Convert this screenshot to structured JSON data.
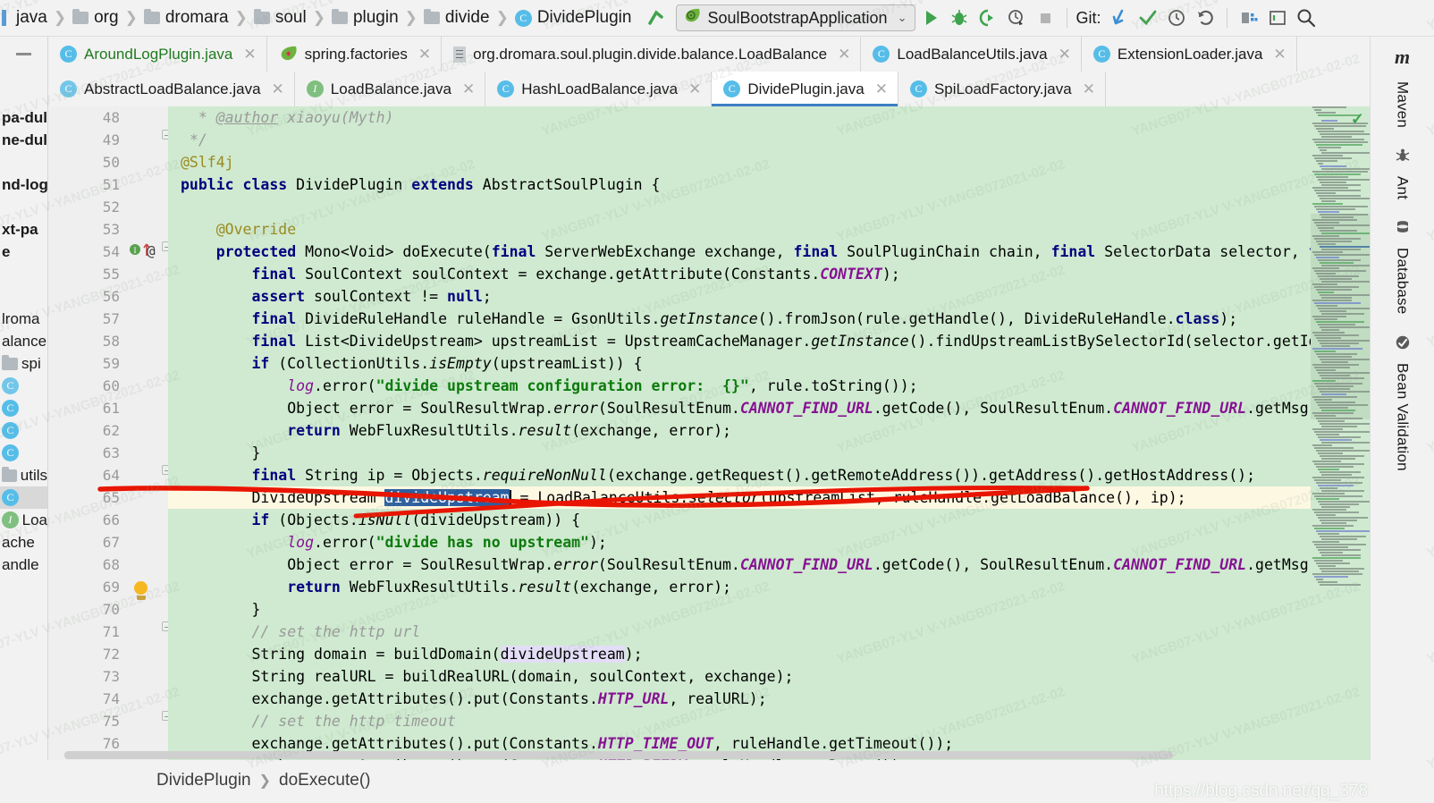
{
  "navbar": {
    "breadcrumbs": [
      {
        "label": "java",
        "icon": "blue-bar-icon"
      },
      {
        "label": "org",
        "icon": "folder-icon"
      },
      {
        "label": "dromara",
        "icon": "folder-icon"
      },
      {
        "label": "soul",
        "icon": "folder-icon"
      },
      {
        "label": "plugin",
        "icon": "folder-icon"
      },
      {
        "label": "divide",
        "icon": "folder-icon"
      },
      {
        "label": "DividePlugin",
        "icon": "class-icon"
      }
    ],
    "run_config": "SoulBootstrapApplication",
    "git_label": "Git:",
    "toolbar_icons": [
      "back-arrow-icon",
      "run-icon",
      "debug-icon",
      "run-with-coverage-icon",
      "profile-icon",
      "stop-icon",
      "git-update-icon",
      "git-commit-icon",
      "git-history-icon",
      "git-rollback-icon",
      "project-structure-icon",
      "terminal-icon",
      "search-everywhere-icon"
    ]
  },
  "tabs_row1": [
    {
      "label": "AroundLogPlugin.java",
      "icon": "class-icon",
      "active": false,
      "green": true
    },
    {
      "label": "spring.factories",
      "icon": "spring-leaf-icon",
      "active": false,
      "green": false
    },
    {
      "label": "org.dromara.soul.plugin.divide.balance.LoadBalance",
      "icon": "xml-file-icon",
      "active": false,
      "green": false
    },
    {
      "label": "LoadBalanceUtils.java",
      "icon": "class-icon",
      "active": false,
      "green": false
    },
    {
      "label": "ExtensionLoader.java",
      "icon": "class-icon",
      "active": false,
      "green": false
    }
  ],
  "tabs_row2": [
    {
      "label": "AbstractLoadBalance.java",
      "icon": "abstract-class-icon",
      "active": false
    },
    {
      "label": "LoadBalance.java",
      "icon": "interface-icon",
      "active": false
    },
    {
      "label": "HashLoadBalance.java",
      "icon": "class-icon",
      "active": false
    },
    {
      "label": "DividePlugin.java",
      "icon": "class-icon",
      "active": true
    },
    {
      "label": "SpiLoadFactory.java",
      "icon": "class-icon",
      "active": false
    }
  ],
  "project_strip": [
    {
      "label": "pa-dul",
      "bold": true
    },
    {
      "label": "ne-dul",
      "bold": true
    },
    {
      "label": "",
      "bold": false
    },
    {
      "label": "nd-log",
      "bold": true
    },
    {
      "label": "",
      "bold": false
    },
    {
      "label": "xt-pa",
      "bold": true
    },
    {
      "label": "e",
      "bold": true
    },
    {
      "label": "",
      "bold": false
    },
    {
      "label": "",
      "bold": false
    },
    {
      "label": "lroma",
      "bold": false
    },
    {
      "label": "alance",
      "bold": false
    },
    {
      "label": "spi",
      "bold": false,
      "icon": "folder-icon"
    },
    {
      "label": "",
      "bold": false,
      "icon": "abstract-class-icon"
    },
    {
      "label": "",
      "bold": false,
      "icon": "class-icon"
    },
    {
      "label": "",
      "bold": false,
      "icon": "class-icon"
    },
    {
      "label": "",
      "bold": false,
      "icon": "class-icon"
    },
    {
      "label": "utils",
      "bold": false,
      "icon": "folder-icon"
    },
    {
      "label": "",
      "bold": false,
      "icon": "class-icon",
      "selected": true
    },
    {
      "label": "Loa",
      "bold": false,
      "icon": "interface-icon"
    },
    {
      "label": "ache",
      "bold": false
    },
    {
      "label": "andle",
      "bold": false
    }
  ],
  "editor": {
    "first_line": 48,
    "highlight_line": 65,
    "lines": [
      {
        "n": 48,
        "html": "  <span class='cmt'>* <u>@author</u> xiaoyu(Myth)</span>"
      },
      {
        "n": 49,
        "html": " <span class='cmt'>*/</span>"
      },
      {
        "n": 50,
        "html": "<span class='anno'>@Slf4j</span>"
      },
      {
        "n": 51,
        "html": "<span class='kw'>public class</span> DividePlugin <span class='kw'>extends</span> AbstractSoulPlugin {"
      },
      {
        "n": 52,
        "html": ""
      },
      {
        "n": 53,
        "html": "    <span class='anno'>@Override</span>"
      },
      {
        "n": 54,
        "html": "    <span class='kw'>protected</span> Mono&lt;Void&gt; doExecute(<span class='kw'>final</span> ServerWebExchange exchange, <span class='kw'>final</span> SoulPluginChain chain, <span class='kw'>final</span> SelectorData selector, <span class='kw'>final</span> RuleData rule) {"
      },
      {
        "n": 55,
        "html": "        <span class='kw'>final</span> SoulContext soulContext = exchange.getAttribute(Constants.<span class='const'>CONTEXT</span>);"
      },
      {
        "n": 56,
        "html": "        <span class='kw'>assert</span> soulContext != <span class='kw'>null</span>;"
      },
      {
        "n": 57,
        "html": "        <span class='kw'>final</span> DivideRuleHandle ruleHandle = GsonUtils.<span class='mth'>getInstance</span>().fromJson(rule.getHandle(), DivideRuleHandle.<span class='kw'>class</span>);"
      },
      {
        "n": 58,
        "html": "        <span class='kw'>final</span> List&lt;DivideUpstream&gt; upstreamList = UpstreamCacheManager.<span class='mth'>getInstance</span>().findUpstreamListBySelectorId(selector.getId());"
      },
      {
        "n": 59,
        "html": "        <span class='kw'>if</span> (CollectionUtils.<span class='mth'>isEmpty</span>(upstreamList)) {"
      },
      {
        "n": 60,
        "html": "            <span class='fld'>log</span>.error(<span class='str'>\"divide upstream configuration error:  {}\"</span>, rule.toString());"
      },
      {
        "n": 61,
        "html": "            Object error = SoulResultWrap.<span class='mth'>error</span>(SoulResultEnum.<span class='const'>CANNOT_FIND_URL</span>.getCode(), SoulResultEnum.<span class='const'>CANNOT_FIND_URL</span>.getMsg(), <span class='hint'>object:</span> <span class='kw'>null</span>);"
      },
      {
        "n": 62,
        "html": "            <span class='kw'>return</span> WebFluxResultUtils.<span class='mth'>result</span>(exchange, error);"
      },
      {
        "n": 63,
        "html": "        }"
      },
      {
        "n": 64,
        "html": "        <span class='kw'>final</span> String ip = Objects.<span class='mth'>requireNonNull</span>(exchange.getRequest().getRemoteAddress()).getAddress().getHostAddress();"
      },
      {
        "n": 65,
        "html": "        DivideUpstream <span class='selrange'>divideUpstream</span><span class='caret'></span> = LoadBalanceUtils.<span class='mth'>selector</span>(upstreamList, ruleHandle.getLoadBalance(), ip);",
        "hl": true
      },
      {
        "n": 66,
        "html": "        <span class='kw'>if</span> (Objects.<span class='mth'>isNull</span>(divideUpstream)) {"
      },
      {
        "n": 67,
        "html": "            <span class='fld'>log</span>.error(<span class='str'>\"divide has no upstream\"</span>);"
      },
      {
        "n": 68,
        "html": "            Object error = SoulResultWrap.<span class='mth'>error</span>(SoulResultEnum.<span class='const'>CANNOT_FIND_URL</span>.getCode(), SoulResultEnum.<span class='const'>CANNOT_FIND_URL</span>.getMsg(), <span class='hint'>object:</span> <span class='kw'>null</span>);"
      },
      {
        "n": 69,
        "html": "            <span class='kw'>return</span> WebFluxResultUtils.<span class='mth'>result</span>(exchange, error);"
      },
      {
        "n": 70,
        "html": "        }"
      },
      {
        "n": 71,
        "html": "        <span class='cmt'>// set the http url</span>"
      },
      {
        "n": 72,
        "html": "        String domain = buildDomain(<span class='usage'>divideUpstream</span>);"
      },
      {
        "n": 73,
        "html": "        String realURL = buildRealURL(domain, soulContext, exchange);"
      },
      {
        "n": 74,
        "html": "        exchange.getAttributes().put(Constants.<span class='const'>HTTP_URL</span>, realURL);"
      },
      {
        "n": 75,
        "html": "        <span class='cmt'>// set the http timeout</span>"
      },
      {
        "n": 76,
        "html": "        exchange.getAttributes().put(Constants.<span class='const'>HTTP_TIME_OUT</span>, ruleHandle.getTimeout());"
      },
      {
        "n": 77,
        "html": "        exchange.getAttributes().put(Constants.<span class='const'>HTTP_RETRY</span>, ruleHandle.getRetry());"
      }
    ]
  },
  "right_strip": [
    {
      "label": "Maven",
      "icon": "maven-m-icon"
    },
    {
      "label": "Ant",
      "icon": "ant-bug-icon"
    },
    {
      "label": "Database",
      "icon": "database-icon"
    },
    {
      "label": "Bean Validation",
      "icon": "bean-validation-icon"
    }
  ],
  "bottom_breadcrumb": [
    "DividePlugin",
    "doExecute()"
  ],
  "watermark": "https://blog.csdn.net/qq_378",
  "tiled_watermark": "YANGB07-YLV  V-YANGB072021-02-02",
  "colors": {
    "code_background": "#cfead0",
    "highlight_line": "#fdf8e2",
    "selection": "#2d5fa0",
    "usage_highlight": "#e3ddf7",
    "active_tab_underline": "#3e7ec4",
    "keyword": "#00007f",
    "string": "#0c7a0c",
    "comment": "#9a9a9a",
    "constant": "#871094",
    "annotation": "#9b8a20",
    "annotation_stroke": "#e81500"
  }
}
